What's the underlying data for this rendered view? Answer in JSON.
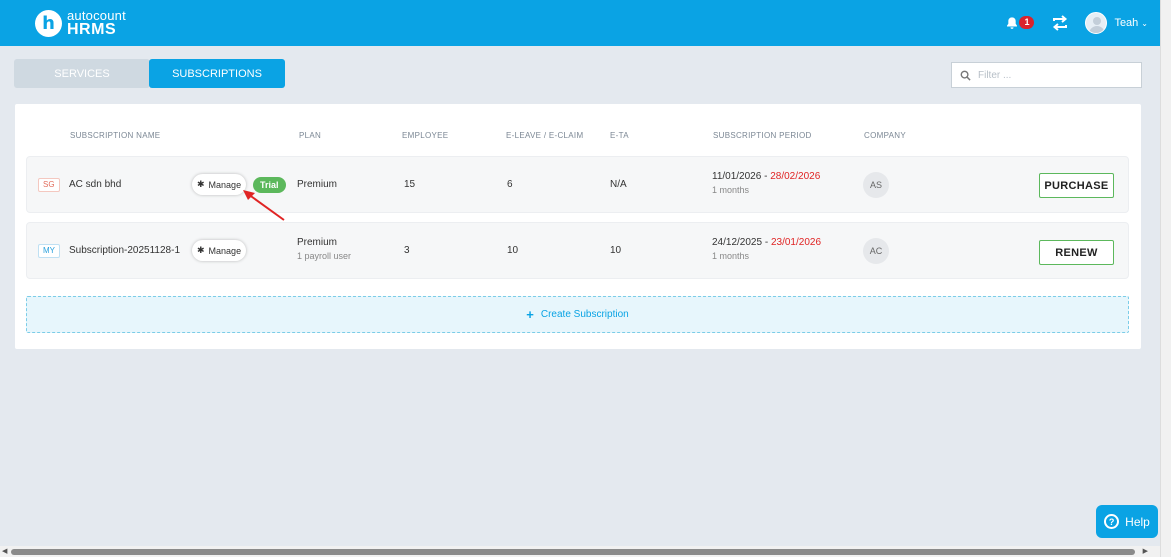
{
  "header": {
    "logo_letter": "h",
    "logo_top": "autocount",
    "logo_bottom": "HRMS",
    "notification_count": "1",
    "user_name": "Teah"
  },
  "tabs": [
    {
      "label": "SERVICES",
      "active": false
    },
    {
      "label": "SUBSCRIPTIONS",
      "active": true
    }
  ],
  "filter": {
    "placeholder": "Filter ..."
  },
  "table": {
    "columns": {
      "name": "SUBSCRIPTION NAME",
      "plan": "PLAN",
      "employee": "EMPLOYEE",
      "eleave": "E-LEAVE / E-CLAIM",
      "eta": "E-TA",
      "period": "SUBSCRIPTION PERIOD",
      "company": "COMPANY"
    },
    "rows": [
      {
        "country": "SG",
        "name": "AC sdn bhd",
        "manage_label": "Manage",
        "trial_label": "Trial",
        "plan": "Premium",
        "plan_sub": "",
        "employee": "15",
        "eleave": "6",
        "eta": "N/A",
        "period_start": "11/01/2026",
        "period_sep": " - ",
        "period_end": "28/02/2026",
        "period_length": "1 months",
        "company": "AS",
        "action": "PURCHASE"
      },
      {
        "country": "MY",
        "name": "Subscription-20251128-1",
        "manage_label": "Manage",
        "plan": "Premium",
        "plan_sub": "1 payroll user",
        "employee": "3",
        "eleave": "10",
        "eta": "10",
        "period_start": "24/12/2025",
        "period_sep": " - ",
        "period_end": "23/01/2026",
        "period_length": "1 months",
        "company": "AC",
        "action": "RENEW"
      }
    ]
  },
  "create_label": "Create Subscription",
  "help_label": "Help",
  "colors": {
    "primary": "#0aa3e4",
    "trial": "#5cb85c",
    "expiry": "#e02424",
    "alert": "#d9232d"
  }
}
